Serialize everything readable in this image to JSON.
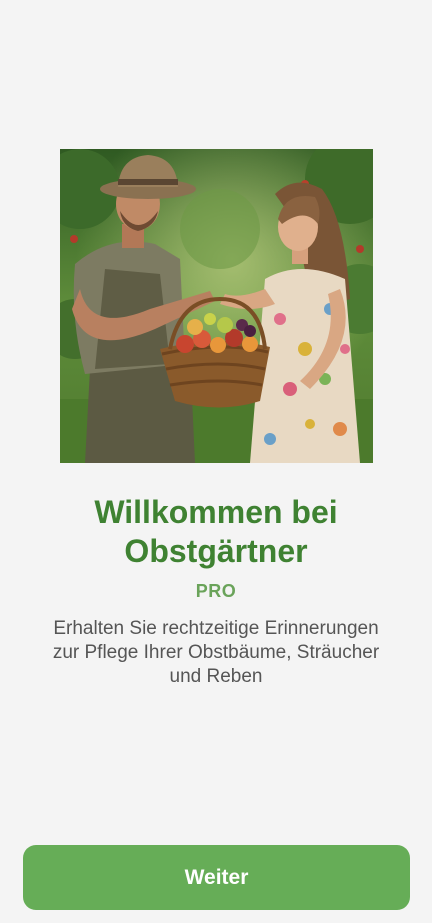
{
  "onboarding": {
    "title": "Willkommen bei Obstgärtner",
    "badge": "PRO",
    "description": "Erhalten Sie rechtzeitige Erinnerungen zur Pflege Ihrer Obstbäume, Sträucher und Reben",
    "continue_label": "Weiter"
  },
  "colors": {
    "background": "#f4f4f4",
    "title": "#3f8232",
    "badge": "#6aa35a",
    "description": "#555555",
    "button": "#66ad57",
    "button_text": "#ffffff"
  }
}
